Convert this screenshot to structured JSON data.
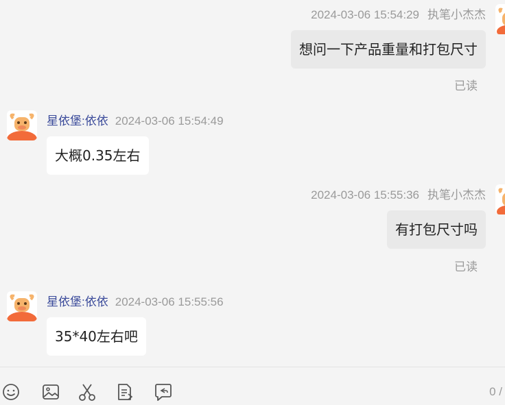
{
  "messages": [
    {
      "side": "right",
      "time": "2024-03-06 15:54:29",
      "sender": "执笔小杰杰",
      "text": "想问一下产品重量和打包尺寸",
      "status": "已读"
    },
    {
      "side": "left",
      "time": "2024-03-06 15:54:49",
      "sender": "星依堡:依依",
      "text": "大概0.35左右"
    },
    {
      "side": "right",
      "time": "2024-03-06 15:55:36",
      "sender": "执笔小杰杰",
      "text": "有打包尺寸吗",
      "status": "已读"
    },
    {
      "side": "left",
      "time": "2024-03-06 15:55:56",
      "sender": "星依堡:依依",
      "text": "35*40左右吧"
    }
  ],
  "toolbar": {
    "icons": [
      "emoji-icon",
      "image-icon",
      "scissors-icon",
      "document-icon",
      "chat-reply-icon"
    ],
    "counter": "0 /"
  },
  "colors": {
    "background": "#f4f4f4",
    "bubble_right": "#e9e9e9",
    "bubble_left": "#ffffff",
    "sender_name": "#3a4a9a",
    "meta_gray": "#9a9a9a",
    "avatar_orange": "#f26b3a"
  }
}
